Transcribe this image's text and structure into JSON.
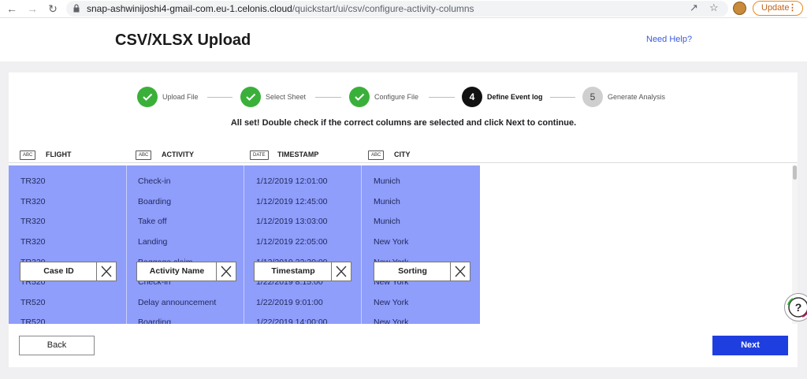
{
  "browser": {
    "url_host": "snap-ashwinijoshi4-gmail-com.eu-1.celonis.cloud",
    "url_path": "/quickstart/ui/csv/configure-activity-columns",
    "update_label": "Update"
  },
  "header": {
    "title": "CSV/XLSX Upload",
    "help_label": "Need Help?"
  },
  "stepper": {
    "steps": [
      {
        "label": "Upload File",
        "state": "done",
        "number": ""
      },
      {
        "label": "Select Sheet",
        "state": "done",
        "number": ""
      },
      {
        "label": "Configure File",
        "state": "done",
        "number": ""
      },
      {
        "label": "Define Event log",
        "state": "active",
        "number": "4"
      },
      {
        "label": "Generate Analysis",
        "state": "todo",
        "number": "5"
      }
    ],
    "message": "All set! Double check if the correct columns are selected and click Next to continue."
  },
  "columns": [
    {
      "type": "ABC",
      "name": "FLIGHT",
      "role": "Case ID",
      "cells": [
        "TR320",
        "TR320",
        "TR320",
        "TR320",
        "TR320",
        "TR520",
        "TR520",
        "TR520"
      ]
    },
    {
      "type": "ABC",
      "name": "ACTIVITY",
      "role": "Activity Name",
      "cells": [
        "Check-in",
        "Boarding",
        "Take off",
        "Landing",
        "Baggage claim",
        "Check-in",
        "Delay announcement",
        "Boarding"
      ]
    },
    {
      "type": "DATE",
      "name": "TIMESTAMP",
      "role": "Timestamp",
      "cells": [
        "1/12/2019 12:01:00",
        "1/12/2019 12:45:00",
        "1/12/2019 13:03:00",
        "1/12/2019 22:05:00",
        "1/12/2019 22:30:00",
        "1/22/2019 8:15:00",
        "1/22/2019 9:01:00",
        "1/22/2019 14:00:00"
      ]
    },
    {
      "type": "ABC",
      "name": "CITY",
      "role": "Sorting",
      "cells": [
        "Munich",
        "Munich",
        "Munich",
        "New York",
        "New York",
        "New York",
        "New York",
        "New York"
      ]
    }
  ],
  "footer": {
    "back_label": "Back",
    "next_label": "Next"
  },
  "colors": {
    "accent": "#1f3ee0",
    "step_done": "#3ab03a",
    "selected_column": "#8f9dfb"
  }
}
